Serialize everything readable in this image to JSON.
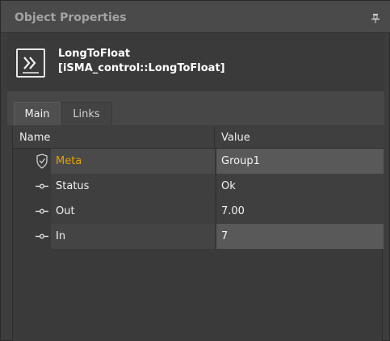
{
  "panel": {
    "title": "Object Properties",
    "pin_icon": "pin-icon"
  },
  "object": {
    "icon": "double-chevron-right-icon",
    "name": "LongToFloat",
    "type": "[iSMA_control::LongToFloat]"
  },
  "tabs": [
    {
      "label": "Main",
      "active": true
    },
    {
      "label": "Links",
      "active": false
    }
  ],
  "grid": {
    "columns": [
      "Name",
      "Value"
    ],
    "rows": [
      {
        "icon": "shield-check-icon",
        "name": "Meta",
        "value": "Group1",
        "highlight_color": "#e6a300"
      },
      {
        "icon": "slot-icon",
        "name": "Status",
        "value": "Ok"
      },
      {
        "icon": "slot-icon",
        "name": "Out",
        "value": "7.00"
      },
      {
        "icon": "slot-icon",
        "name": "In",
        "value": "7"
      }
    ]
  }
}
